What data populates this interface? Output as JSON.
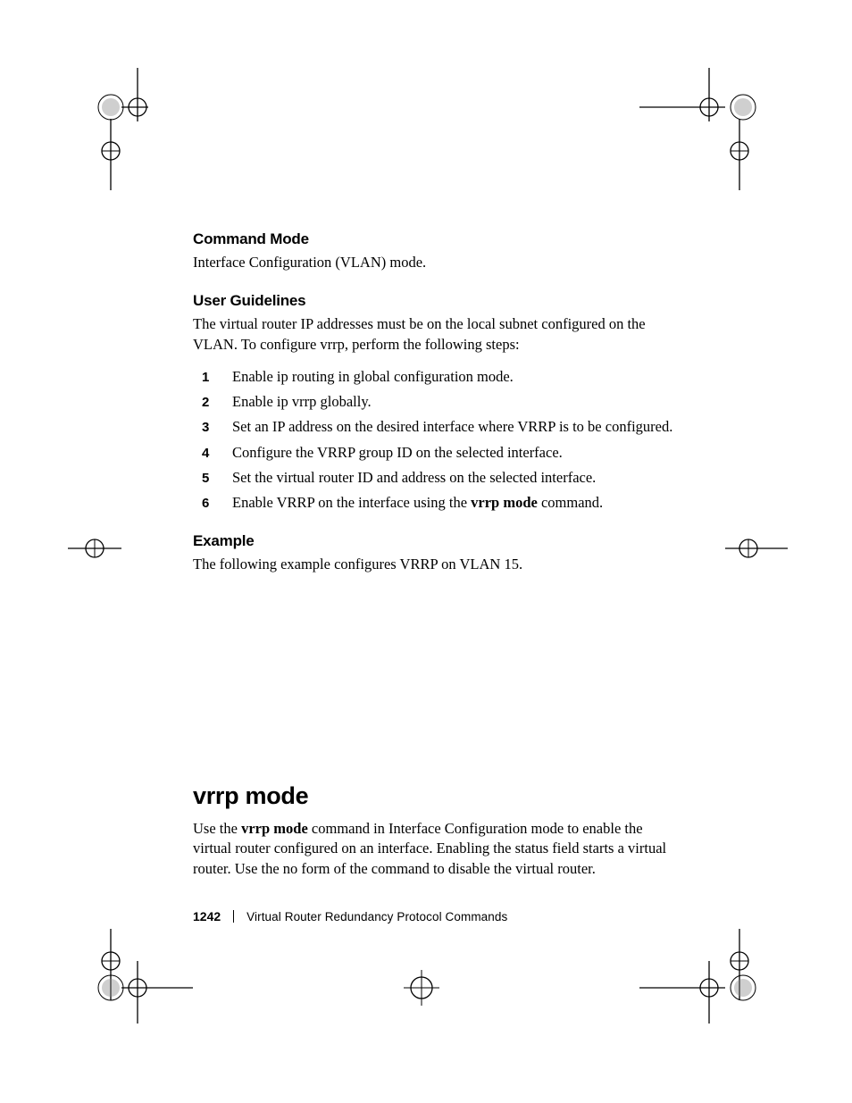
{
  "headings": {
    "command_mode": "Command Mode",
    "user_guidelines": "User Guidelines",
    "example": "Example",
    "vrrp_mode": "vrrp mode"
  },
  "body": {
    "command_mode_text": "Interface Configuration (VLAN) mode.",
    "user_guidelines_intro": "The virtual router IP addresses must be on the local subnet configured on the VLAN. To configure vrrp, perform the following steps:",
    "example_text": "The following example configures VRRP on VLAN 15.",
    "vrrp_mode_text_pre": "Use the ",
    "vrrp_mode_bold": "vrrp mode",
    "vrrp_mode_text_post": " command in Interface Configuration mode to enable the virtual router configured on an interface. Enabling the status field starts a virtual router. Use the no form of the command to disable the virtual router."
  },
  "steps": [
    {
      "n": "1",
      "text": "Enable ip routing in global configuration mode."
    },
    {
      "n": "2",
      "text": "Enable ip vrrp globally."
    },
    {
      "n": "3",
      "text": "Set an IP address on the desired interface where VRRP is to be configured."
    },
    {
      "n": "4",
      "text": "Configure the VRRP group ID on the selected interface."
    },
    {
      "n": "5",
      "text": "Set the virtual router ID and address on the selected interface."
    },
    {
      "n": "6",
      "pre": "Enable VRRP on the interface using the ",
      "bold": "vrrp mode",
      "post": " command."
    }
  ],
  "footer": {
    "page_number": "1242",
    "section_title": "Virtual Router Redundancy Protocol Commands"
  }
}
